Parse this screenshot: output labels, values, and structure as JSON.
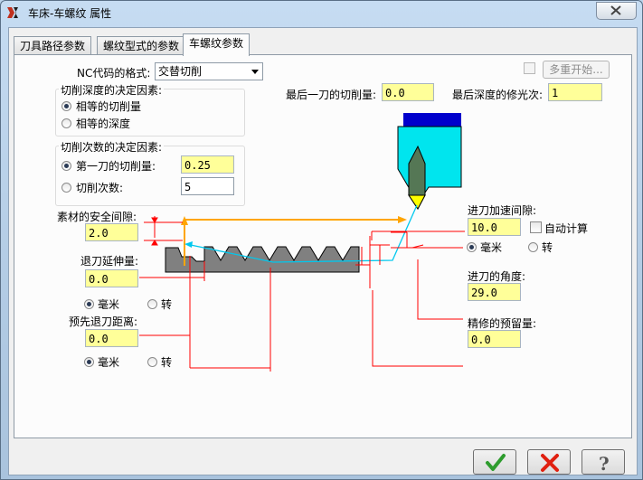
{
  "window": {
    "title": "车床-车螺纹 属性"
  },
  "tabs": [
    {
      "label": "刀具路径参数"
    },
    {
      "label": "螺纹型式的参数"
    },
    {
      "label": "车螺纹参数"
    }
  ],
  "nc_format": {
    "label": "NC代码的格式:",
    "value": "交替切削"
  },
  "multi_start": {
    "label": "多重开始..."
  },
  "depth_group": {
    "title": "切削深度的决定因素:",
    "option1": "相等的切削量",
    "option2": "相等的深度"
  },
  "count_group": {
    "title": "切削次数的决定因素:",
    "option1": "第一刀的切削量:",
    "option1_value": "0.25",
    "option2": "切削次数:",
    "option2_value": "5"
  },
  "last_cut": {
    "label": "最后一刀的切削量:",
    "value": "0.0"
  },
  "finish_passes": {
    "label": "最后深度的修光次:",
    "value": "1"
  },
  "stock_clearance": {
    "label": "素材的安全间隙:",
    "value": "2.0"
  },
  "overrun": {
    "label": "退刀延伸量:",
    "value": "0.0"
  },
  "overrun_units": {
    "mm": "毫米",
    "rev": "转"
  },
  "pre_retract": {
    "label": "预先退刀距离:",
    "value": "0.0"
  },
  "pre_retract_units": {
    "mm": "毫米",
    "rev": "转"
  },
  "accel_clearance": {
    "label": "进刀加速间隙:",
    "value": "10.0",
    "auto_calc": "自动计算"
  },
  "accel_units": {
    "mm": "毫米",
    "rev": "转"
  },
  "entry_angle": {
    "label": "进刀的角度:",
    "value": "29.0"
  },
  "finish_allowance": {
    "label": "精修的预留量:",
    "value": "0.0"
  },
  "buttons": {
    "ok": "ok-icon",
    "cancel": "cancel-icon",
    "help": "help-icon"
  },
  "colors": {
    "accent_yellow": "#ffff99",
    "tool_cyan": "#00e5ee",
    "tool_holder": "#0000cc",
    "path_orange": "#ffa500",
    "dimension_red": "#ff0000"
  }
}
